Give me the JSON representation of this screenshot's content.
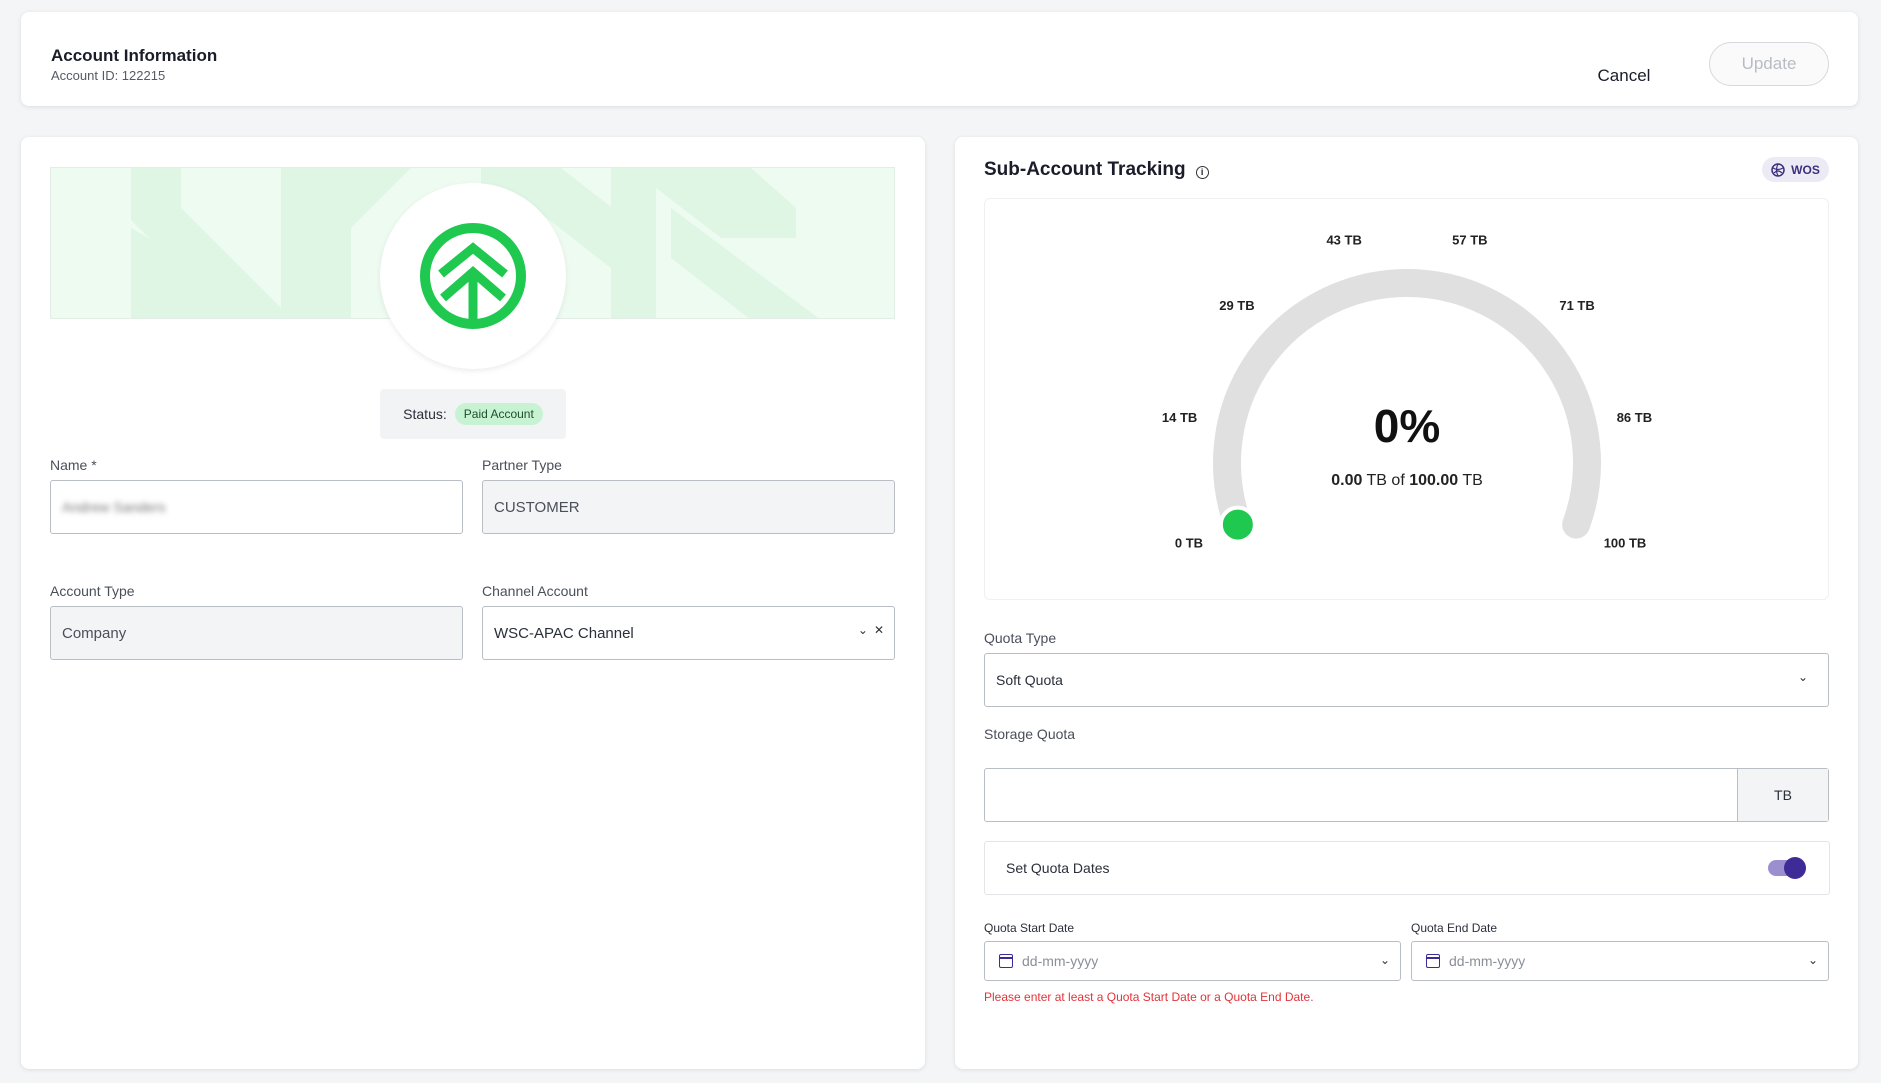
{
  "header": {
    "title": "Account Information",
    "account_id": "Account ID: 122215",
    "cancel_label": "Cancel",
    "update_label": "Update"
  },
  "profile": {
    "status_label": "Status:",
    "status_value": "Paid Account",
    "brand_color": "#1fc94f"
  },
  "form": {
    "name_label": "Name *",
    "name_value": "Andrew Sanders",
    "partner_type_label": "Partner Type",
    "partner_type_value": "CUSTOMER",
    "account_type_label": "Account Type",
    "account_type_value": "Company",
    "channel_account_label": "Channel Account",
    "channel_account_value": "WSC-APAC Channel"
  },
  "tracking": {
    "title": "Sub-Account Tracking",
    "badge": "WOS",
    "gauge": {
      "percent_text": "0%",
      "used": "0.00",
      "unit": "TB",
      "of": "of",
      "total": "100.00",
      "percent": 0,
      "ticks": [
        "0 TB",
        "14 TB",
        "29 TB",
        "43 TB",
        "57 TB",
        "71 TB",
        "86 TB",
        "100 TB"
      ],
      "track_color": "#e0e0e0",
      "fill_color": "#1fc94f"
    },
    "quota_type_label": "Quota Type",
    "quota_type_value": "Soft Quota",
    "storage_quota_label": "Storage Quota",
    "storage_quota_value": "",
    "storage_unit": "TB",
    "set_dates_label": "Set Quota Dates",
    "set_dates_enabled": true,
    "start_date_label": "Quota Start Date",
    "start_date_placeholder": "dd-mm-yyyy",
    "end_date_label": "Quota End Date",
    "end_date_placeholder": "dd-mm-yyyy",
    "error_message": "Please enter at least a Quota Start Date or a Quota End Date.",
    "accent_color": "#3f2b97"
  }
}
